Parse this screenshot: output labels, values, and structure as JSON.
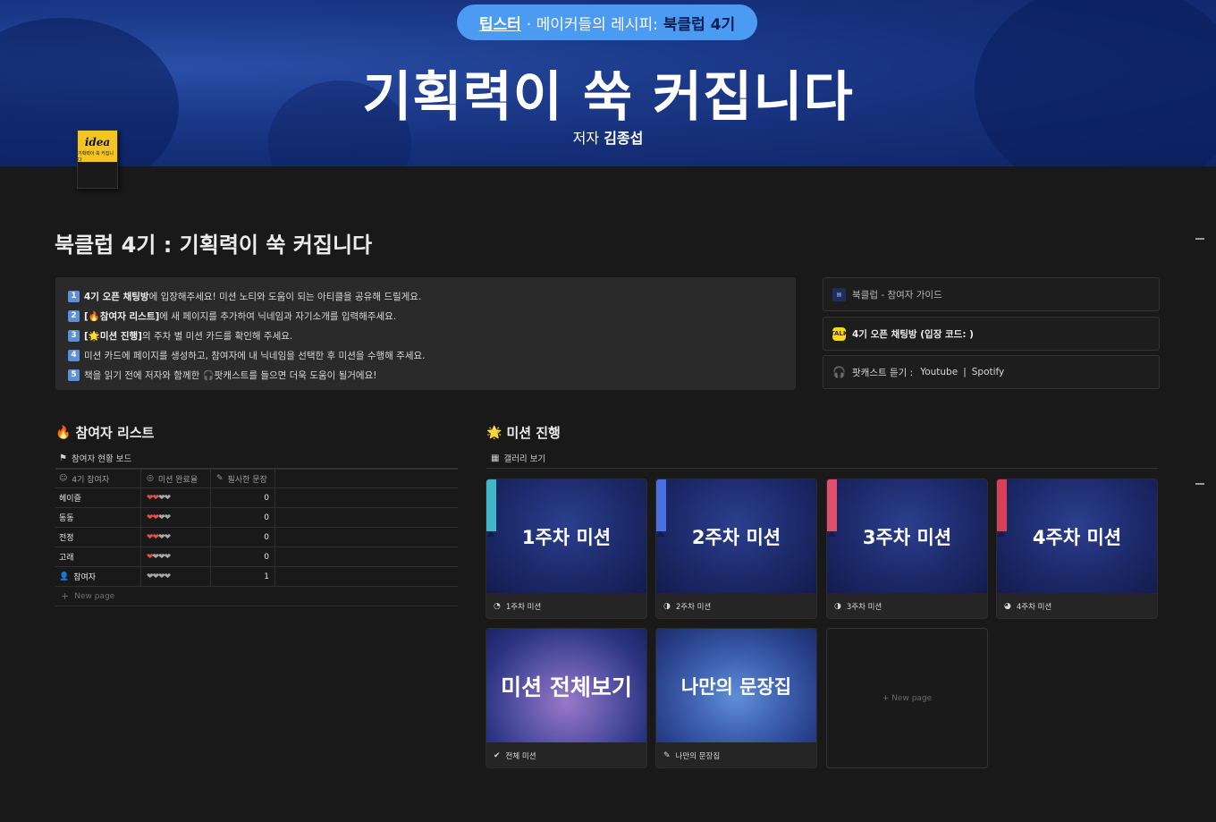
{
  "banner": {
    "pill_brand": "팁스터",
    "pill_middle": "· 메이커들의 레시피:",
    "pill_strong": "북클럽 4기",
    "title": "기획력이 쑥 커집니다",
    "author_label": "저자",
    "author_name": "김종섭",
    "book_cover_title": "idea",
    "book_cover_sub": "기획력이 쑥 커집니다"
  },
  "page": {
    "title": "북클럽 4기 : 기획력이 쑥 커집니다"
  },
  "instructions": [
    {
      "num": "1",
      "bold": "4기 오픈 채팅방",
      "text": "에 입장해주세요! 미션 노티와 도움이 되는 아티클을 공유해 드릴게요."
    },
    {
      "num": "2",
      "bold": "[🔥참여자 리스트]",
      "text": "에 새 페이지를 추가하여 닉네임과 자기소개를 입력해주세요."
    },
    {
      "num": "3",
      "bold": "[🌟미션 진행]",
      "text": "의 주차 별 미션 카드를 확인해 주세요."
    },
    {
      "num": "4",
      "bold": "",
      "text": "미션 카드에 페이지를 생성하고, 참여자에 내 닉네임을 선택한 후 미션을 수행해 주세요."
    },
    {
      "num": "5",
      "bold": "",
      "text": "책을 읽기 전에 저자와 함께한 🎧팟캐스트를 들으면 더욱 도움이 될거에요!"
    }
  ],
  "links": {
    "guide": "북클럽 - 참여자 가이드",
    "chat": "4기 오픈 채팅방 (입장 코드: )",
    "podcast_label": "팟캐스트 듣기 :",
    "podcast_youtube": "Youtube",
    "podcast_sep": "|",
    "podcast_spotify": "Spotify"
  },
  "participants": {
    "heading": "참여자 리스트",
    "view_tab": "참여자 현황 보드",
    "columns": [
      "4기 참여자",
      "미션 완료율",
      "필사한 문장"
    ],
    "rows": [
      {
        "name": "헤이즐",
        "red": "❤❤",
        "gray": "❤❤",
        "count": "0"
      },
      {
        "name": "동동",
        "red": "❤❤",
        "gray": "❤❤",
        "count": "0"
      },
      {
        "name": "전정",
        "red": "❤❤",
        "gray": "❤❤",
        "count": "0"
      },
      {
        "name": "고래",
        "red": "❤",
        "gray": "❤❤❤",
        "count": "0"
      },
      {
        "name": "참여자",
        "red": "",
        "gray": "❤❤❤❤",
        "count": "1"
      }
    ],
    "new_page": "New page"
  },
  "missions": {
    "heading": "미션 진행",
    "view_tab": "갤러리 보기",
    "cards": [
      {
        "cover": "1주차 미션",
        "caption": "1주차 미션",
        "ribbon": "#3fb7c9"
      },
      {
        "cover": "2주차 미션",
        "caption": "2주차 미션",
        "ribbon": "#4a6fe0"
      },
      {
        "cover": "3주차 미션",
        "caption": "3주차 미션",
        "ribbon": "#e0506e"
      },
      {
        "cover": "4주차 미션",
        "caption": "4주차 미션",
        "ribbon": "#d8405a"
      },
      {
        "cover": "미션 전체보기",
        "caption": "전체 미션"
      },
      {
        "cover": "나만의 문장집",
        "caption": "나만의 문장집"
      }
    ],
    "new_page": "New page"
  }
}
